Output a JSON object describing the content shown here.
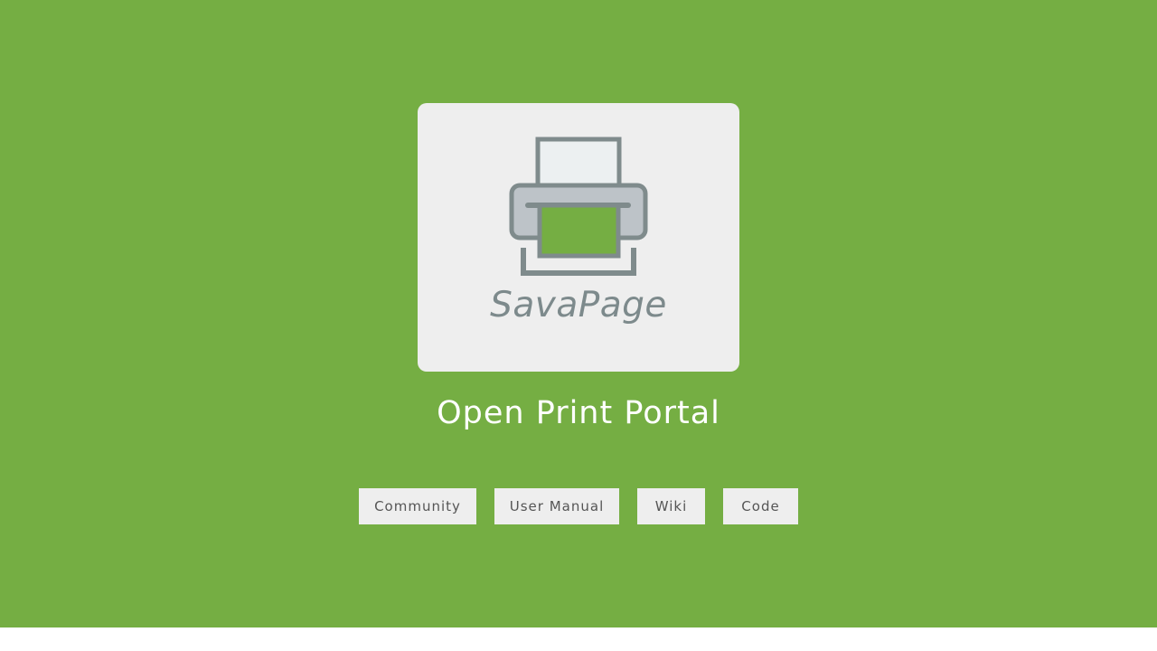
{
  "brand": {
    "name": "SavaPage",
    "logo_icon": "printer-icon",
    "tagline": "Open Print Portal"
  },
  "nav": {
    "buttons": [
      {
        "label": "Community"
      },
      {
        "label": "User Manual"
      },
      {
        "label": "Wiki"
      },
      {
        "label": "Code"
      }
    ]
  },
  "colors": {
    "background": "#75ae43",
    "card": "#eeeeee",
    "icon_gray": "#7f8b8c",
    "button_bg": "#eeeeee",
    "button_text": "#555555",
    "footer": "#ffffff"
  }
}
